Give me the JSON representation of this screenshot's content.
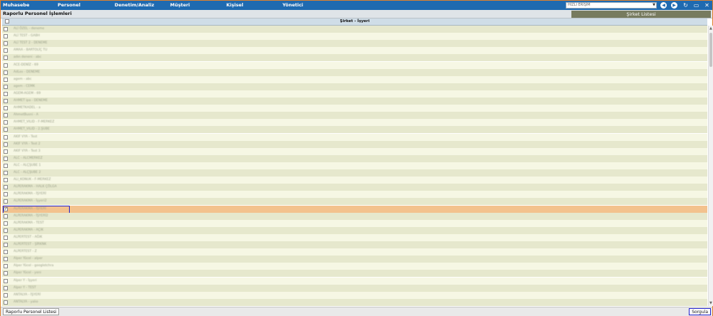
{
  "menu": [
    "Muhasebe",
    "Personel",
    "Denetim/Analiz",
    "Müşteri",
    "Kişisel",
    "Yönetici"
  ],
  "quick_access": {
    "placeholder": "HIZLI ERİŞİM",
    "dropdown_icon": "chevron-down-icon"
  },
  "toolbar_icons": [
    "back-icon",
    "forward-icon",
    "refresh-icon",
    "window-icon",
    "close-icon"
  ],
  "page_title": "Raporlu Personel İşlemleri",
  "right_tab": "Şirket Listesi",
  "column_header": "Şirket - İşyeri",
  "rows": [
    "ALİ ÖZEL - deneme",
    "ALİ TEST - GABH",
    "ALİ TEST 2 - DENEME",
    "AMAA - BARTOLİÇ TU",
    "adın deneni - abc",
    "ACE-DENİZ - 69",
    "AdLes - DENEME",
    "agem - abc",
    "agem - CEMK",
    "AGEM-AGEM - 69",
    "AHMET ipa - DENEME",
    "AHMETKADEL - a",
    "AhmetBusni - A",
    "AHMET_VILID - F-MERKEZ",
    "AHMET_VILID - 2.ŞUBE",
    "AKIF VYA - Test",
    "AKIF VYA - Test 2",
    "AKIF VYA - Test 3",
    "ALC - ALCMERKEZ",
    "ALC - ALÇŞUBE 1",
    "ALC - ALÇŞUBE 2",
    "ALI_KONUK - F-MERKEZ",
    "ALPERAKMA - HALK ÇÖLGA",
    "ALPERAKMA - İŞYERİ",
    "ALPERAKMA - İşyeri2",
    "ALPERAKMA - İŞYERİ",
    "ALPERAKMA - İŞYERİ2",
    "ALPERAKMA - TEST",
    "ALPERAKMA - AÇIK",
    "ALPERTEST - AĞIK",
    "ALPERTEST - ŞİRKNK",
    "ALPERTEST - Z",
    "Alper Yücel - alper",
    "Alper Yücel - googletchra",
    "Alper Yücel - yeni",
    "Alper Y - İşyeri",
    "Alper Y - TEST",
    "ANTALYA - İŞYERİ",
    "ANTALYA - yalıo"
  ],
  "selected_index": 25,
  "footer": {
    "left_button": "Raporlu Personel Listesi",
    "right_button": "Sorgula"
  },
  "colors": {
    "topbar": "#1f6ab0",
    "selected_row": "#f3c28e",
    "row_odd": "#e6e8cd",
    "row_even": "#f6f7e4",
    "highlight_border": "#2222cc",
    "frame": "#e0802c"
  }
}
